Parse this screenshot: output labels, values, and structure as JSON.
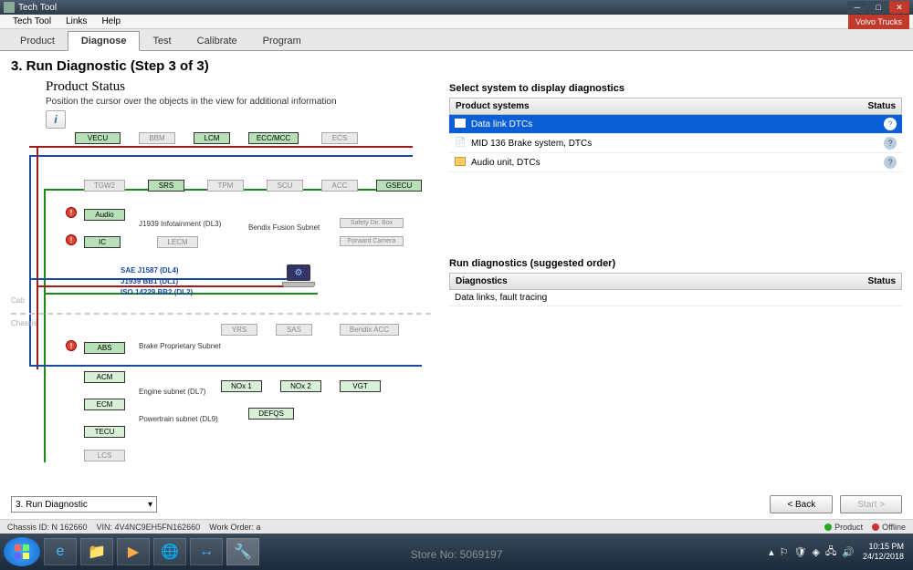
{
  "window": {
    "title": "Tech Tool"
  },
  "menu": {
    "items": [
      "Tech Tool",
      "Links",
      "Help"
    ],
    "badge": "Volvo Trucks"
  },
  "tabs": {
    "items": [
      "Product",
      "Diagnose",
      "Test",
      "Calibrate",
      "Program"
    ],
    "active": 1
  },
  "step": {
    "title": "3. Run Diagnostic (Step 3 of 3)"
  },
  "left": {
    "title": "Product Status",
    "subtitle": "Position the cursor over the objects in the view for additional information",
    "nodes": {
      "vecu": "VECU",
      "bbm": "BBM",
      "lcm": "LCM",
      "eccmcc": "ECC/MCC",
      "ecs": "ECS",
      "tgw2": "TGW2",
      "srs": "SRS",
      "tpm": "TPM",
      "scu": "SCU",
      "acc": "ACC",
      "gsecu": "GSECU",
      "audio": "Audio",
      "ic": "IC",
      "lecm": "LECM",
      "safety": "Safety Dir. Box",
      "camera": "Forward Camera",
      "yrs": "YRS",
      "sas": "SAS",
      "bendixacc": "Bendix ACC",
      "abs": "ABS",
      "acm": "ACM",
      "ecm": "ECM",
      "tecu": "TECU",
      "lcs": "LCS",
      "nox1": "NOx 1",
      "nox2": "NOx 2",
      "vgt": "VGT",
      "defqs": "DEFQS"
    },
    "labels": {
      "infotainment": "J1939 Infotainment (DL3)",
      "fusion": "Bendix Fusion Subnet",
      "sae": "SAE J1587 (DL4)",
      "bb1": "J1939 BB1 (DL1)",
      "bb2": "ISO 14229 BB2 (DL2)",
      "brake": "Brake Proprietary Subnet",
      "engine": "Engine subnet (DL7)",
      "powertrain": "Powertrain subnet (DL9)",
      "cab": "Cab",
      "chassis": "Chassis"
    }
  },
  "right": {
    "select_title": "Select system to display diagnostics",
    "systems_header": {
      "col1": "Product systems",
      "col2": "Status"
    },
    "systems": [
      {
        "label": "Data link DTCs",
        "selected": true
      },
      {
        "label": "MID 136 Brake system, DTCs",
        "selected": false
      },
      {
        "label": "Audio unit, DTCs",
        "selected": false
      }
    ],
    "diag_title": "Run diagnostics (suggested order)",
    "diag_header": {
      "col1": "Diagnostics",
      "col2": "Status"
    },
    "diag_rows": [
      {
        "label": "Data links, fault tracing"
      }
    ]
  },
  "bottom": {
    "dropdown": "3. Run Diagnostic",
    "back": "< Back",
    "start": "Start >"
  },
  "status": {
    "chassis": "Chassis ID: N 162660",
    "vin": "VIN: 4V4NC9EH5FN162660",
    "workorder": "Work Order: a",
    "product": "Product",
    "offline": "Offline"
  },
  "tray": {
    "time": "10:15 PM",
    "date": "24/12/2018"
  },
  "watermark": "Store No: 5069197"
}
